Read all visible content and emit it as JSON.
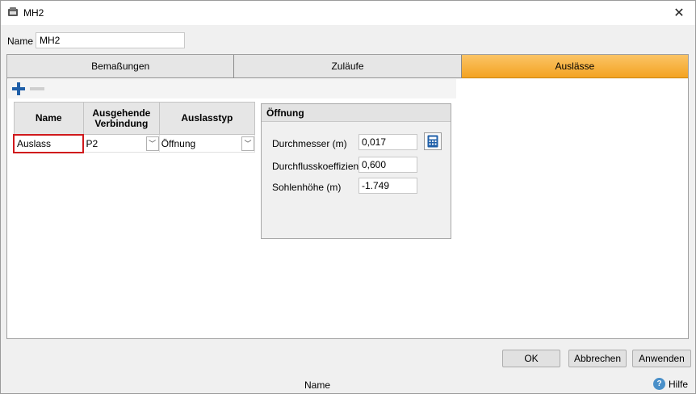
{
  "window": {
    "title": "MH2"
  },
  "name_field": {
    "label": "Name",
    "value": "MH2"
  },
  "tabs": [
    {
      "label": "Bemaßungen",
      "active": false
    },
    {
      "label": "Zuläufe",
      "active": false
    },
    {
      "label": "Auslässe",
      "active": true
    }
  ],
  "grid": {
    "headers": [
      "Name",
      "Ausgehende Verbindung",
      "Auslasstyp"
    ],
    "rows": [
      {
        "name": "Auslass",
        "verbindung": "P2",
        "typ": "Öffnung"
      }
    ]
  },
  "opening_group": {
    "title": "Öffnung",
    "diameter_label": "Durchmesser (m)",
    "diameter_value": "0,017",
    "coeff_label": "Durchflusskoeffizient",
    "coeff_value": "0,600",
    "invert_label": "Sohlenhöhe (m)",
    "invert_value": "-1.749"
  },
  "buttons": {
    "ok": "OK",
    "cancel": "Abbrechen",
    "apply": "Anwenden"
  },
  "statusbar": {
    "text": "Name",
    "help": "Hilfe"
  },
  "colors": {
    "active_tab": "#f3a322",
    "error_border": "#d0191c",
    "accent": "#1f5fa8"
  }
}
